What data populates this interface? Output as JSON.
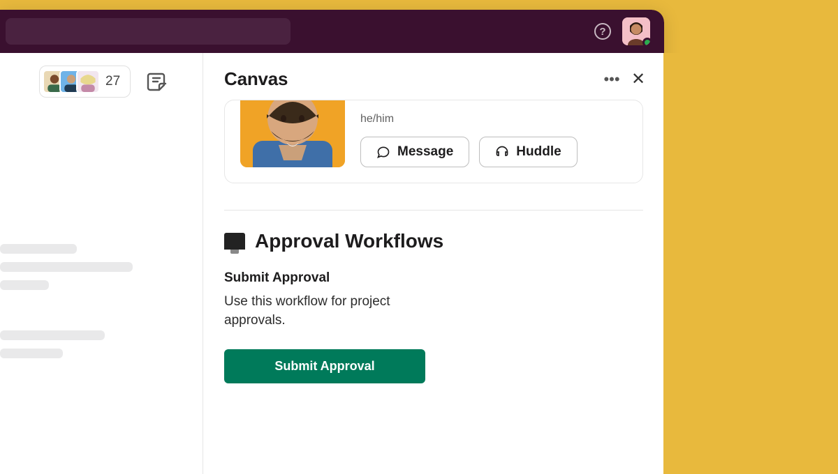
{
  "titlebar": {
    "help_tooltip": "Help"
  },
  "sidebar": {
    "member_count": "27"
  },
  "panel": {
    "title": "Canvas",
    "more": "•••",
    "close": "✕"
  },
  "profile": {
    "pronoun": "he/him",
    "message_label": "Message",
    "huddle_label": "Huddle"
  },
  "workflow": {
    "heading": "Approval Workflows",
    "subheading": "Submit Approval",
    "description": "Use this workflow for project approvals.",
    "cta_label": "Submit Approval"
  }
}
